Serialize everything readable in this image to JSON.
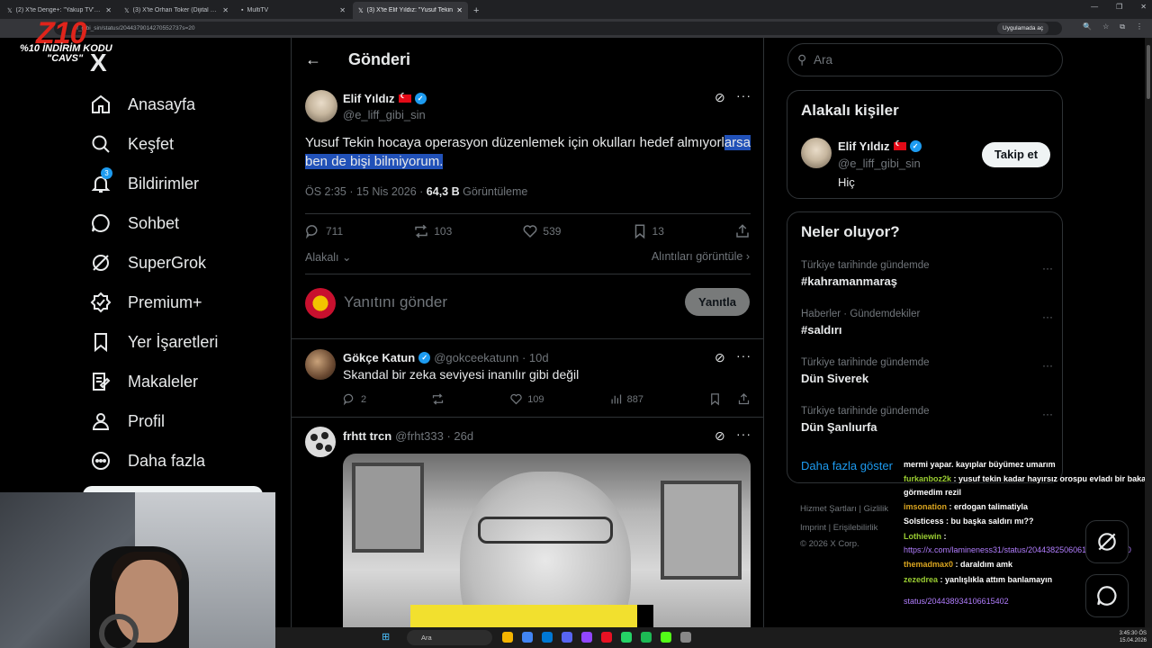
{
  "browser": {
    "tabs": [
      {
        "title": "(2) X'te Denge+: \"Yakup TV'nin",
        "active": false
      },
      {
        "title": "(3) X'te Orhan Toker (Dijital Bab",
        "active": false
      },
      {
        "title": "MultiTV",
        "active": false
      },
      {
        "title": "(3) X'te Elif Yıldız: \"Yusuf Tekin",
        "active": true
      }
    ],
    "url": "iff_gibi_sin/status/2044379014270552737s=20",
    "app_button": "Uygulamada aç"
  },
  "promo": {
    "brand": "Z10",
    "line1": "%10 İNDİRİM KODU",
    "line2": "\"CAVS\""
  },
  "nav": {
    "logo": "X",
    "items": [
      {
        "label": "Anasayfa",
        "icon": "home-icon"
      },
      {
        "label": "Keşfet",
        "icon": "search-icon"
      },
      {
        "label": "Bildirimler",
        "icon": "bell-icon",
        "badge": "3"
      },
      {
        "label": "Sohbet",
        "icon": "chat-icon"
      },
      {
        "label": "SuperGrok",
        "icon": "grok-icon"
      },
      {
        "label": "Premium+",
        "icon": "premium-icon"
      },
      {
        "label": "Yer İşaretleri",
        "icon": "bookmark-icon"
      },
      {
        "label": "Makaleler",
        "icon": "article-icon"
      },
      {
        "label": "Profil",
        "icon": "profile-icon"
      },
      {
        "label": "Daha fazla",
        "icon": "more-circle-icon"
      }
    ]
  },
  "header": {
    "title": "Gönderi"
  },
  "post": {
    "author": "Elif Yıldız",
    "handle": "@e_liff_gibi_sin",
    "text_plain": "Yusuf Tekin hocaya operasyon düzenlemek için okulları hedef almıyorl",
    "text_selected": "arsa ben de bişi bilmiyorum.",
    "time": "ÖS 2:35 · 15 Nis 2026 · ",
    "views": "64,3 B",
    "views_label": " Görüntüleme",
    "stats": {
      "replies": "711",
      "reposts": "103",
      "likes": "539",
      "bookmarks": "13"
    },
    "related_label": "Alakalı",
    "quotes_label": "Alıntıları görüntüle"
  },
  "composer": {
    "placeholder": "Yanıtını gönder",
    "button": "Yanıtla"
  },
  "replies": [
    {
      "author": "Gökçe Katun",
      "handle": "@gokceekatunn · 10d",
      "text": "Skandal bir zeka seviyesi inanılır gibi değil",
      "stats": {
        "replies": "2",
        "likes": "109",
        "views": "887"
      }
    },
    {
      "author": "frhtt trcn",
      "handle": "@frht333 · 26d"
    }
  ],
  "search": {
    "placeholder": "Ara"
  },
  "related_people": {
    "title": "Alakalı kişiler",
    "name": "Elif Yıldız",
    "handle": "@e_liff_gibi_sin",
    "bio": "Hiç",
    "follow": "Takip et"
  },
  "trends": {
    "title": "Neler oluyor?",
    "items": [
      {
        "category": "Türkiye tarihinde gündemde",
        "topic": "#kahramanmaraş"
      },
      {
        "category": "Haberler · Gündemdekiler",
        "topic": "#saldırı"
      },
      {
        "category": "Türkiye tarihinde gündemde",
        "topic": "Dün Siverek"
      },
      {
        "category": "Türkiye tarihinde gündemde",
        "topic": "Dün Şanlıurfa"
      }
    ],
    "show_more": "Daha fazla göster"
  },
  "footer": {
    "row1": "Hizmet Şartları   |   Gizlilik",
    "row2": "Imprint   |   Erişilebilirlik",
    "row3": "© 2026 X Corp."
  },
  "chat": [
    {
      "user": "",
      "msg": "mermi yapar. kayıplar büyümez umarım",
      "color": "#ffffff"
    },
    {
      "user": "furkanboz2k",
      "msg": " : yusuf tekin kadar hayırsız orospu evladı bir bakan görmedim rezil",
      "color": "#9acd32"
    },
    {
      "user": "imsonation",
      "msg": " : erdogan talimatiyla",
      "color": "#daa520"
    },
    {
      "user": "Solsticess",
      "msg": " : bu başka saldırı mı??",
      "color": "#ffffff"
    },
    {
      "user": "Lothiewin",
      "msg": " : ",
      "color": "#9acd32"
    },
    {
      "user": "",
      "msg": "https://x.com/lamineness31/status/204438250606190605?s=20",
      "color": "#b27eff"
    },
    {
      "user": "themadmax0",
      "msg": " : daraldım amk",
      "color": "#daa520"
    },
    {
      "user": "zezedrea",
      "msg": " : yanlışlıkla attım banlamayın",
      "color": "#9acd32"
    },
    {
      "user": "",
      "msg": "status/204438934106615402",
      "color": "#b27eff"
    }
  ],
  "taskbar": {
    "search": "Ara",
    "time": "3:45:30 ÖS",
    "date": "15.04.2026"
  }
}
